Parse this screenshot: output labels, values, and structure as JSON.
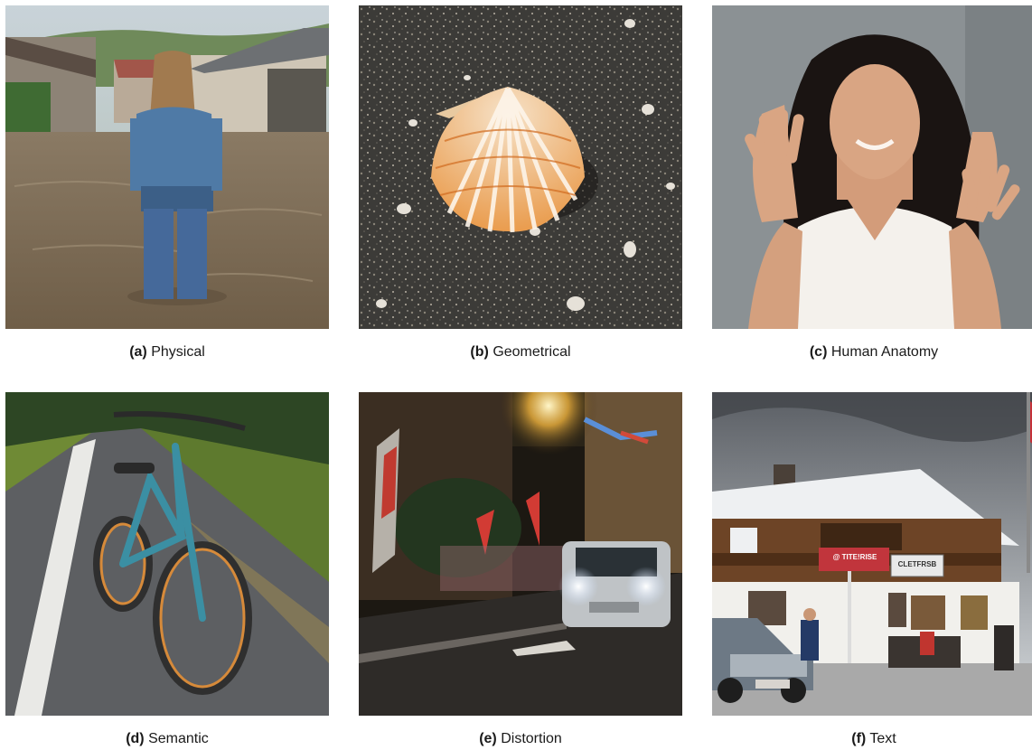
{
  "panels": [
    {
      "letter": "(a)",
      "label": "Physical"
    },
    {
      "letter": "(b)",
      "label": "Geometrical"
    },
    {
      "letter": "(c)",
      "label": "Human Anatomy"
    },
    {
      "letter": "(d)",
      "label": "Semantic"
    },
    {
      "letter": "(e)",
      "label": "Distortion"
    },
    {
      "letter": "(f)",
      "label": "Text"
    }
  ],
  "signs": {
    "red_sign": "@ TITE!RISE",
    "white_sign": "CLETFRSB"
  }
}
